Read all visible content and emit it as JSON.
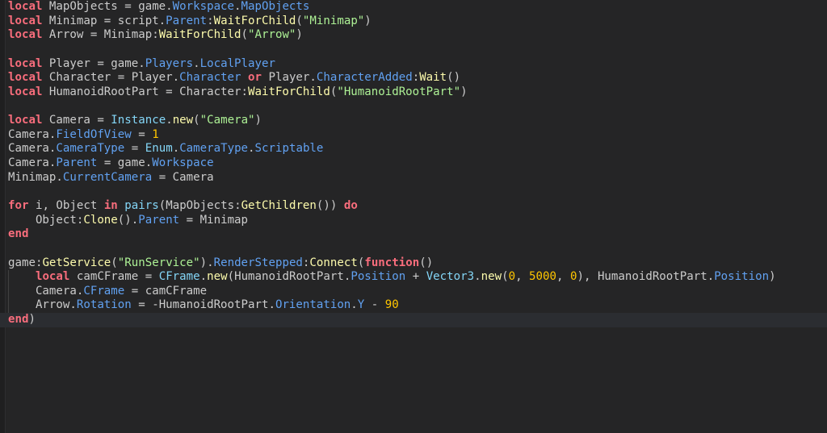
{
  "editor": {
    "language": "Luau",
    "current_line_index": 22,
    "colors": {
      "background": "#252526",
      "current_line": "#2b2d31",
      "keyword": "#f86d7c",
      "identifier": "#cccccc",
      "property": "#61a1f1",
      "method": "#fdfbac",
      "string": "#adf195",
      "number": "#ffc600",
      "builtin": "#84d6f7"
    },
    "lines": [
      [
        {
          "t": "kw",
          "v": "local"
        },
        {
          "t": "ident",
          "v": " MapObjects = game."
        },
        {
          "t": "prop",
          "v": "Workspace"
        },
        {
          "t": "ident",
          "v": "."
        },
        {
          "t": "prop",
          "v": "MapObjects"
        }
      ],
      [
        {
          "t": "kw",
          "v": "local"
        },
        {
          "t": "ident",
          "v": " Minimap = script."
        },
        {
          "t": "prop",
          "v": "Parent"
        },
        {
          "t": "ident",
          "v": ":"
        },
        {
          "t": "method",
          "v": "WaitForChild"
        },
        {
          "t": "ident",
          "v": "("
        },
        {
          "t": "str",
          "v": "\"Minimap\""
        },
        {
          "t": "ident",
          "v": ")"
        }
      ],
      [
        {
          "t": "kw",
          "v": "local"
        },
        {
          "t": "ident",
          "v": " Arrow = Minimap:"
        },
        {
          "t": "method",
          "v": "WaitForChild"
        },
        {
          "t": "ident",
          "v": "("
        },
        {
          "t": "str",
          "v": "\"Arrow\""
        },
        {
          "t": "ident",
          "v": ")"
        }
      ],
      [],
      [
        {
          "t": "kw",
          "v": "local"
        },
        {
          "t": "ident",
          "v": " Player = game."
        },
        {
          "t": "prop",
          "v": "Players"
        },
        {
          "t": "ident",
          "v": "."
        },
        {
          "t": "prop",
          "v": "LocalPlayer"
        }
      ],
      [
        {
          "t": "kw",
          "v": "local"
        },
        {
          "t": "ident",
          "v": " Character = Player."
        },
        {
          "t": "prop",
          "v": "Character"
        },
        {
          "t": "ident",
          "v": " "
        },
        {
          "t": "kw",
          "v": "or"
        },
        {
          "t": "ident",
          "v": " Player."
        },
        {
          "t": "prop",
          "v": "CharacterAdded"
        },
        {
          "t": "ident",
          "v": ":"
        },
        {
          "t": "method",
          "v": "Wait"
        },
        {
          "t": "ident",
          "v": "()"
        }
      ],
      [
        {
          "t": "kw",
          "v": "local"
        },
        {
          "t": "ident",
          "v": " HumanoidRootPart = Character:"
        },
        {
          "t": "method",
          "v": "WaitForChild"
        },
        {
          "t": "ident",
          "v": "("
        },
        {
          "t": "str",
          "v": "\"HumanoidRootPart\""
        },
        {
          "t": "ident",
          "v": ")"
        }
      ],
      [],
      [
        {
          "t": "kw",
          "v": "local"
        },
        {
          "t": "ident",
          "v": " Camera = "
        },
        {
          "t": "builtin",
          "v": "Instance"
        },
        {
          "t": "ident",
          "v": "."
        },
        {
          "t": "method",
          "v": "new"
        },
        {
          "t": "ident",
          "v": "("
        },
        {
          "t": "str",
          "v": "\"Camera\""
        },
        {
          "t": "ident",
          "v": ")"
        }
      ],
      [
        {
          "t": "ident",
          "v": "Camera."
        },
        {
          "t": "prop",
          "v": "FieldOfView"
        },
        {
          "t": "ident",
          "v": " = "
        },
        {
          "t": "num",
          "v": "1"
        }
      ],
      [
        {
          "t": "ident",
          "v": "Camera."
        },
        {
          "t": "prop",
          "v": "CameraType"
        },
        {
          "t": "ident",
          "v": " = "
        },
        {
          "t": "builtin",
          "v": "Enum"
        },
        {
          "t": "ident",
          "v": "."
        },
        {
          "t": "prop",
          "v": "CameraType"
        },
        {
          "t": "ident",
          "v": "."
        },
        {
          "t": "prop",
          "v": "Scriptable"
        }
      ],
      [
        {
          "t": "ident",
          "v": "Camera."
        },
        {
          "t": "prop",
          "v": "Parent"
        },
        {
          "t": "ident",
          "v": " = game."
        },
        {
          "t": "prop",
          "v": "Workspace"
        }
      ],
      [
        {
          "t": "ident",
          "v": "Minimap."
        },
        {
          "t": "prop",
          "v": "CurrentCamera"
        },
        {
          "t": "ident",
          "v": " = Camera"
        }
      ],
      [],
      [
        {
          "t": "kw",
          "v": "for"
        },
        {
          "t": "ident",
          "v": " i, Object "
        },
        {
          "t": "kw",
          "v": "in"
        },
        {
          "t": "ident",
          "v": " "
        },
        {
          "t": "builtin",
          "v": "pairs"
        },
        {
          "t": "ident",
          "v": "(MapObjects:"
        },
        {
          "t": "method",
          "v": "GetChildren"
        },
        {
          "t": "ident",
          "v": "()) "
        },
        {
          "t": "kw",
          "v": "do"
        }
      ],
      [
        {
          "t": "ident",
          "v": "    Object:"
        },
        {
          "t": "method",
          "v": "Clone"
        },
        {
          "t": "ident",
          "v": "()."
        },
        {
          "t": "prop",
          "v": "Parent"
        },
        {
          "t": "ident",
          "v": " = Minimap"
        }
      ],
      [
        {
          "t": "kw",
          "v": "end"
        }
      ],
      [],
      [
        {
          "t": "ident",
          "v": "game:"
        },
        {
          "t": "method",
          "v": "GetService"
        },
        {
          "t": "ident",
          "v": "("
        },
        {
          "t": "str",
          "v": "\"RunService\""
        },
        {
          "t": "ident",
          "v": ")."
        },
        {
          "t": "prop",
          "v": "RenderStepped"
        },
        {
          "t": "ident",
          "v": ":"
        },
        {
          "t": "method",
          "v": "Connect"
        },
        {
          "t": "ident",
          "v": "("
        },
        {
          "t": "kw",
          "v": "function"
        },
        {
          "t": "ident",
          "v": "()"
        }
      ],
      [
        {
          "t": "ident",
          "v": "    "
        },
        {
          "t": "kw",
          "v": "local"
        },
        {
          "t": "ident",
          "v": " camCFrame = "
        },
        {
          "t": "builtin",
          "v": "CFrame"
        },
        {
          "t": "ident",
          "v": "."
        },
        {
          "t": "method",
          "v": "new"
        },
        {
          "t": "ident",
          "v": "(HumanoidRootPart."
        },
        {
          "t": "prop",
          "v": "Position"
        },
        {
          "t": "ident",
          "v": " + "
        },
        {
          "t": "builtin",
          "v": "Vector3"
        },
        {
          "t": "ident",
          "v": "."
        },
        {
          "t": "method",
          "v": "new"
        },
        {
          "t": "ident",
          "v": "("
        },
        {
          "t": "num",
          "v": "0"
        },
        {
          "t": "ident",
          "v": ", "
        },
        {
          "t": "num",
          "v": "5000"
        },
        {
          "t": "ident",
          "v": ", "
        },
        {
          "t": "num",
          "v": "0"
        },
        {
          "t": "ident",
          "v": "), HumanoidRootPart."
        },
        {
          "t": "prop",
          "v": "Position"
        },
        {
          "t": "ident",
          "v": ")"
        }
      ],
      [
        {
          "t": "ident",
          "v": "    Camera."
        },
        {
          "t": "prop",
          "v": "CFrame"
        },
        {
          "t": "ident",
          "v": " = camCFrame"
        }
      ],
      [
        {
          "t": "ident",
          "v": "    Arrow."
        },
        {
          "t": "prop",
          "v": "Rotation"
        },
        {
          "t": "ident",
          "v": " = -HumanoidRootPart."
        },
        {
          "t": "prop",
          "v": "Orientation"
        },
        {
          "t": "ident",
          "v": "."
        },
        {
          "t": "prop",
          "v": "Y"
        },
        {
          "t": "ident",
          "v": " - "
        },
        {
          "t": "num",
          "v": "90"
        }
      ],
      [
        {
          "t": "kw",
          "v": "end"
        },
        {
          "t": "ident",
          "v": ")"
        }
      ]
    ]
  }
}
